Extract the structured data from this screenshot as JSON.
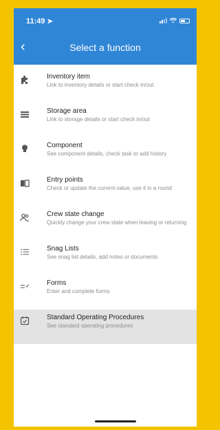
{
  "status_bar": {
    "time": "11:49"
  },
  "header": {
    "back_label": "‹",
    "title": "Select a function",
    "accent": "#2f86d6"
  },
  "functions": [
    {
      "icon": "puzzle-icon",
      "title": "Inventory item",
      "subtitle": "Link to inventory details or start check in/out"
    },
    {
      "icon": "list-icon",
      "title": "Storage area",
      "subtitle": "Link to storage details or start check in/out"
    },
    {
      "icon": "lightbulb-icon",
      "title": "Component",
      "subtitle": "See component details, check task or add history"
    },
    {
      "icon": "book-icon",
      "title": "Entry points",
      "subtitle": "Check or update the current value, use it in a round"
    },
    {
      "icon": "crew-icon",
      "title": "Crew state change",
      "subtitle": "Quickly change your crew state when leaving or returning"
    },
    {
      "icon": "bullet-list-icon",
      "title": "Snag Lists",
      "subtitle": "See snag list details, add notes or documents"
    },
    {
      "icon": "checklist-icon",
      "title": "Forms",
      "subtitle": "Enter and complete forms"
    },
    {
      "icon": "calendar-check-icon",
      "title": "Standard Operating Procedures",
      "subtitle": "See standard operating procedures",
      "selected": true
    }
  ]
}
